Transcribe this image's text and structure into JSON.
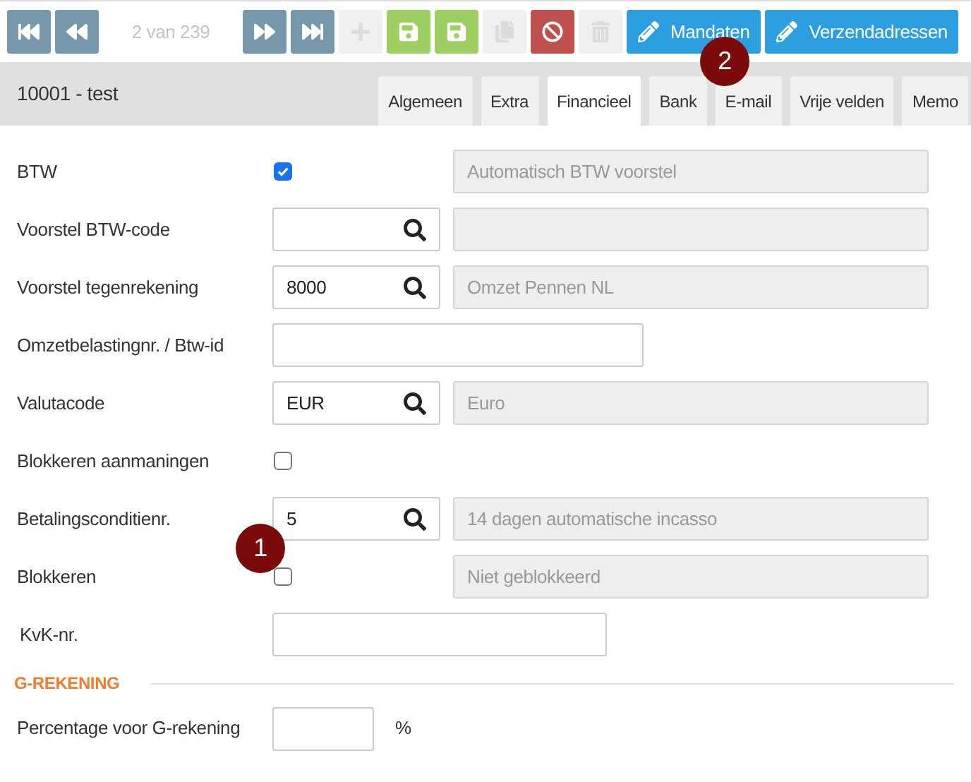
{
  "toolbar": [
    {
      "kind": "nav",
      "disabled": false
    },
    {
      "kind": "nav",
      "disabled": false
    },
    {
      "kind": "counter",
      "text": "2 van 239"
    },
    {
      "kind": "nav",
      "disabled": false
    },
    {
      "kind": "nav",
      "disabled": false
    },
    {
      "kind": "plain",
      "disabled": true
    },
    {
      "kind": "save",
      "disabled": false
    },
    {
      "kind": "save",
      "disabled": false
    },
    {
      "kind": "plain",
      "disabled": true
    },
    {
      "kind": "danger",
      "disabled": false
    },
    {
      "kind": "plain",
      "disabled": true
    },
    {
      "kind": "link",
      "label": "Mandaten",
      "disabled": false
    },
    {
      "kind": "link",
      "label": "Verzendadressen",
      "disabled": false
    }
  ],
  "record_title": "10001 - test",
  "tabs": [
    {
      "label": "Algemeen",
      "selected": false
    },
    {
      "label": "Extra",
      "selected": false
    },
    {
      "label": "Financieel",
      "selected": true
    },
    {
      "label": "Bank",
      "selected": false
    },
    {
      "label": "E-mail",
      "selected": false
    },
    {
      "label": "Vrije velden",
      "selected": false
    },
    {
      "label": "Memo",
      "selected": false
    }
  ],
  "fields": [
    {
      "kind": "checkbox",
      "label": "BTW",
      "checked": true,
      "description": "Automatisch BTW voorstel"
    },
    {
      "kind": "lookup",
      "label": "Voorstel BTW-code"
    },
    {
      "kind": "lookup",
      "label": "Voorstel tegenrekening",
      "value": "8000",
      "description": "Omzet Pennen NL"
    },
    {
      "kind": "text",
      "label": "Omzetbelastingnr. / Btw-id"
    },
    {
      "kind": "lookup",
      "label": "Valutacode",
      "value": "EUR",
      "description": "Euro"
    },
    {
      "kind": "checkbox",
      "label": "Blokkeren aanmaningen",
      "checked": false
    },
    {
      "kind": "lookup",
      "label": "Betalingsconditienr.",
      "value": "5",
      "description": "14 dagen automatische incasso"
    },
    {
      "kind": "checkbox",
      "label": "Blokkeren",
      "checked": false,
      "description": "Niet geblokkeerd"
    },
    {
      "kind": "short",
      "label": "KvK-nr."
    }
  ],
  "section": {
    "title": "G-REKENING",
    "fields": [
      {
        "label": "Percentage voor G-rekening",
        "unit": "%"
      }
    ]
  },
  "callouts": [
    {
      "text": "1"
    },
    {
      "text": "2"
    }
  ]
}
